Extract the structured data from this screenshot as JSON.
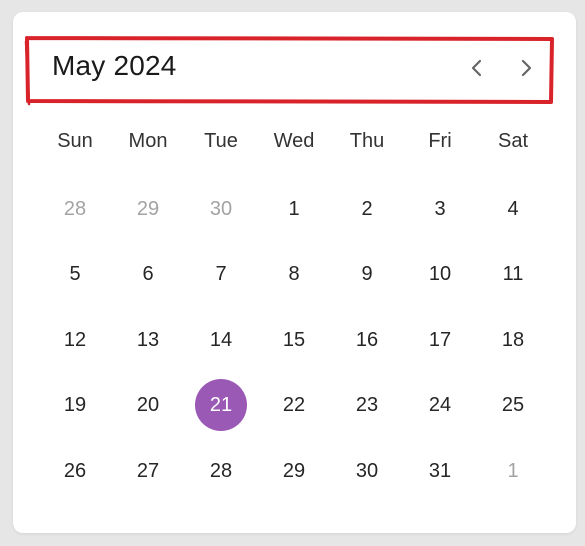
{
  "header": {
    "title": "May 2024",
    "prev_icon": "chevron-left-icon",
    "next_icon": "chevron-right-icon"
  },
  "weekdays": [
    "Sun",
    "Mon",
    "Tue",
    "Wed",
    "Thu",
    "Fri",
    "Sat"
  ],
  "weeks": [
    [
      {
        "label": "28",
        "outside": true
      },
      {
        "label": "29",
        "outside": true
      },
      {
        "label": "30",
        "outside": true
      },
      {
        "label": "1"
      },
      {
        "label": "2"
      },
      {
        "label": "3"
      },
      {
        "label": "4"
      }
    ],
    [
      {
        "label": "5"
      },
      {
        "label": "6"
      },
      {
        "label": "7"
      },
      {
        "label": "8"
      },
      {
        "label": "9"
      },
      {
        "label": "10"
      },
      {
        "label": "11"
      }
    ],
    [
      {
        "label": "12"
      },
      {
        "label": "13"
      },
      {
        "label": "14"
      },
      {
        "label": "15"
      },
      {
        "label": "16"
      },
      {
        "label": "17"
      },
      {
        "label": "18"
      }
    ],
    [
      {
        "label": "19"
      },
      {
        "label": "20"
      },
      {
        "label": "21",
        "selected": true
      },
      {
        "label": "22"
      },
      {
        "label": "23"
      },
      {
        "label": "24"
      },
      {
        "label": "25"
      }
    ],
    [
      {
        "label": "26"
      },
      {
        "label": "27"
      },
      {
        "label": "28"
      },
      {
        "label": "29"
      },
      {
        "label": "30"
      },
      {
        "label": "31"
      },
      {
        "label": "1",
        "outside": true
      }
    ]
  ],
  "colors": {
    "selected": "#9b59b6",
    "annotation": "#d9232a",
    "outside_text": "#a3a3a3"
  }
}
